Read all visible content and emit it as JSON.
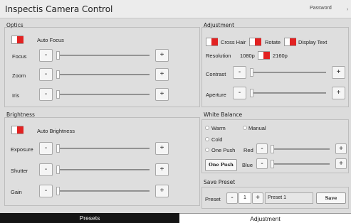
{
  "app": {
    "title": "Inspectis Camera Control",
    "password_label": "Password",
    "menu_arrow": "›"
  },
  "optics": {
    "title": "Optics",
    "autofocus_label": "Auto Focus",
    "rows": [
      {
        "label": "Focus",
        "minus": "-",
        "plus": "+",
        "level": 0
      },
      {
        "label": "Zoom",
        "minus": "-",
        "plus": "+",
        "level": 0
      },
      {
        "label": "Iris",
        "minus": "-",
        "plus": "+",
        "level": 0
      }
    ]
  },
  "adjustment": {
    "title": "Adjustment",
    "crosshair_label": "Cross Hair",
    "rotate_label": "Rotate",
    "display_text_label": "Display Text",
    "resolution_label": "Resolution",
    "res_low": "1080p",
    "res_high": "2160p",
    "rows": [
      {
        "label": "Contrast",
        "minus": "-",
        "plus": "+",
        "level": 0
      },
      {
        "label": "Aperture",
        "minus": "-",
        "plus": "+",
        "level": 0
      }
    ]
  },
  "brightness": {
    "title": "Brightness",
    "auto_label": "Auto Brightness",
    "rows": [
      {
        "label": "Exposure",
        "minus": "-",
        "plus": "+",
        "level": 0
      },
      {
        "label": "Shutter",
        "minus": "-",
        "plus": "+",
        "level": 0
      },
      {
        "label": "Gain",
        "minus": "-",
        "plus": "+",
        "level": 0
      }
    ]
  },
  "white_balance": {
    "title": "White Balance",
    "warm": "Warm",
    "manual": "Manual",
    "cold": "Cold",
    "one_push": "One Push",
    "one_push_button": "One Push",
    "red_label": "Red",
    "blue_label": "Blue",
    "minus": "-",
    "plus": "+"
  },
  "save_preset": {
    "title": "Save Preset",
    "preset_label": "Preset",
    "minus": "-",
    "number": "1",
    "plus": "+",
    "name": "Preset 1",
    "save_button": "Save"
  },
  "tabs": [
    {
      "label": "Presets",
      "active": false
    },
    {
      "label": "Adjustment",
      "active": true
    }
  ],
  "colors": {
    "toggle_on": "#e22222",
    "active_tab": "#ffffff",
    "inactive_tab": "#141414"
  }
}
